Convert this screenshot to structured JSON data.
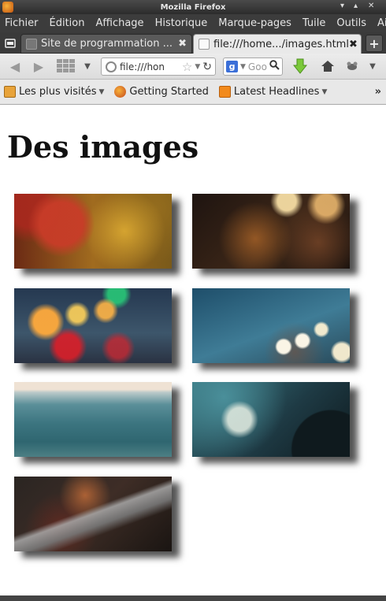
{
  "window": {
    "title": "Mozilla Firefox"
  },
  "menu": [
    "Fichier",
    "Édition",
    "Affichage",
    "Historique",
    "Marque-pages",
    "Tuile",
    "Outils",
    "Aide"
  ],
  "tabs": [
    {
      "label": "Site de programmation ...",
      "active": false
    },
    {
      "label": "file:///home.../images.html",
      "active": true
    }
  ],
  "navbar": {
    "url": "file:///hon",
    "search_placeholder": "Goo"
  },
  "bookmarks": [
    {
      "label": "Les plus visités",
      "icon": "folder-icon",
      "has_dropdown": true
    },
    {
      "label": "Getting Started",
      "icon": "firefox-icon",
      "has_dropdown": false
    },
    {
      "label": "Latest Headlines",
      "icon": "rss-icon",
      "has_dropdown": true
    }
  ],
  "page": {
    "heading": "Des images",
    "images": [
      {
        "subject": "autumn-leaves"
      },
      {
        "subject": "car-night-bokeh"
      },
      {
        "subject": "rain-window-bokeh"
      },
      {
        "subject": "tree-branches-lights"
      },
      {
        "subject": "sea-waves"
      },
      {
        "subject": "turntable"
      },
      {
        "subject": "park-bench"
      }
    ]
  },
  "colors": {
    "titlebar": "#3a3a3a",
    "page_background": "#ffffff",
    "heading": "#111111"
  }
}
